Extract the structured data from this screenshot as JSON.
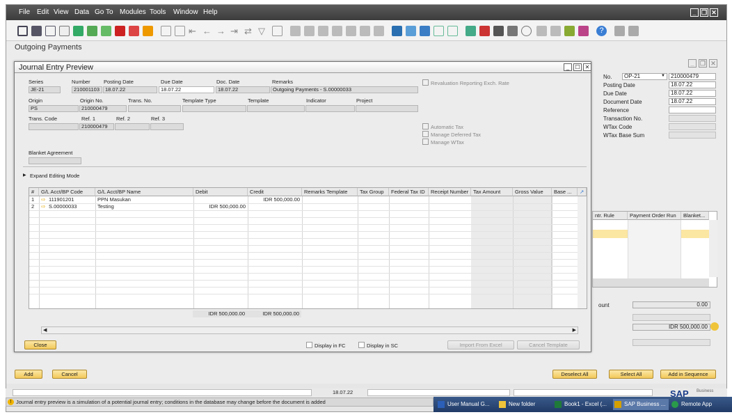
{
  "menu": [
    "File",
    "Edit",
    "View",
    "Data",
    "Go To",
    "Modules",
    "Tools",
    "Window",
    "Help"
  ],
  "bgdoc": {
    "title": "Outgoing Payments",
    "fields": [
      {
        "label": "No.",
        "value": "OP-21",
        "value2": "210000479"
      },
      {
        "label": "Posting Date",
        "value": "18.07.22"
      },
      {
        "label": "Due Date",
        "value": "18.07.22"
      },
      {
        "label": "Document Date",
        "value": "18.07.22"
      },
      {
        "label": "Reference",
        "value": ""
      },
      {
        "label": "Transaction No.",
        "value": ""
      },
      {
        "label": "WTax Code",
        "value": ""
      },
      {
        "label": "WTax Base Sum",
        "value": ""
      }
    ],
    "grid_headers": [
      "ntr. Rule",
      "Payment Order Run",
      "Blanket..."
    ],
    "count_label": "ount",
    "count_value": "0.00",
    "total_value": "IDR 500,000.00",
    "buttons": {
      "add": "Add",
      "cancel": "Cancel",
      "deselect": "Deselect All",
      "select": "Select All",
      "add_seq": "Add in Sequence"
    }
  },
  "dialog": {
    "title": "Journal Entry Preview",
    "series_label": "Series",
    "series": "JE-21",
    "number_label": "Number",
    "number": "210001103",
    "posting_label": "Posting Date",
    "posting": "18.07.22",
    "due_label": "Due Date",
    "due": "18.07.22",
    "docdate_label": "Doc. Date",
    "docdate": "18.07.22",
    "remarks_label": "Remarks",
    "remarks": "Outgoing Payments - S.00000033",
    "origin_label": "Origin",
    "origin": "PS",
    "originno_label": "Origin No.",
    "originno": "210000479",
    "transno_label": "Trans. No.",
    "templtype_label": "Template Type",
    "templ_label": "Template",
    "indicator_label": "Indicator",
    "project_label": "Project",
    "transcode_label": "Trans. Code",
    "ref1_label": "Ref. 1",
    "ref1": "210000479",
    "ref2_label": "Ref. 2",
    "ref3_label": "Ref. 3",
    "blanket_label": "Blanket Agreement",
    "reval_label": "Revaluation Reporting Exch. Rate",
    "autotax_label": "Automatic Tax",
    "deferred_label": "Manage Deferred Tax",
    "wtax_label": "Manage WTax",
    "expand_label": "Expand Editing Mode",
    "grid": {
      "headers": [
        "#",
        "G/L Acct/BP Code",
        "G/L Acct/BP Name",
        "Debit",
        "Credit",
        "Remarks Template",
        "Tax Group",
        "Federal Tax ID",
        "Receipt Number",
        "Tax Amount",
        "Gross Value",
        "Base ..."
      ],
      "rows": [
        {
          "n": "1",
          "code": "111901201",
          "name": "PPN Masukan",
          "debit": "",
          "credit": "IDR 500,000.00"
        },
        {
          "n": "2",
          "code": "S.00000033",
          "name": "Testing",
          "debit": "IDR 500,000.00",
          "credit": ""
        }
      ],
      "total_debit": "IDR 500,000.00",
      "total_credit": "IDR 500,000.00"
    },
    "close_label": "Close",
    "fc_label": "Display in FC",
    "sc_label": "Display in SC",
    "import_label": "Import From Excel",
    "cancel_tmpl_label": "Cancel Template"
  },
  "status": {
    "date": "18.07.22",
    "message": "Journal entry preview is a simulation of a potential journal entry; conditions in the database may change before the document is added",
    "sap_logo": "SAP",
    "sap_business": "Business"
  },
  "taskbar": [
    "User Manual G...",
    "New folder",
    "Book1 - Excel (...",
    "SAP Business ...",
    "Remote App"
  ]
}
